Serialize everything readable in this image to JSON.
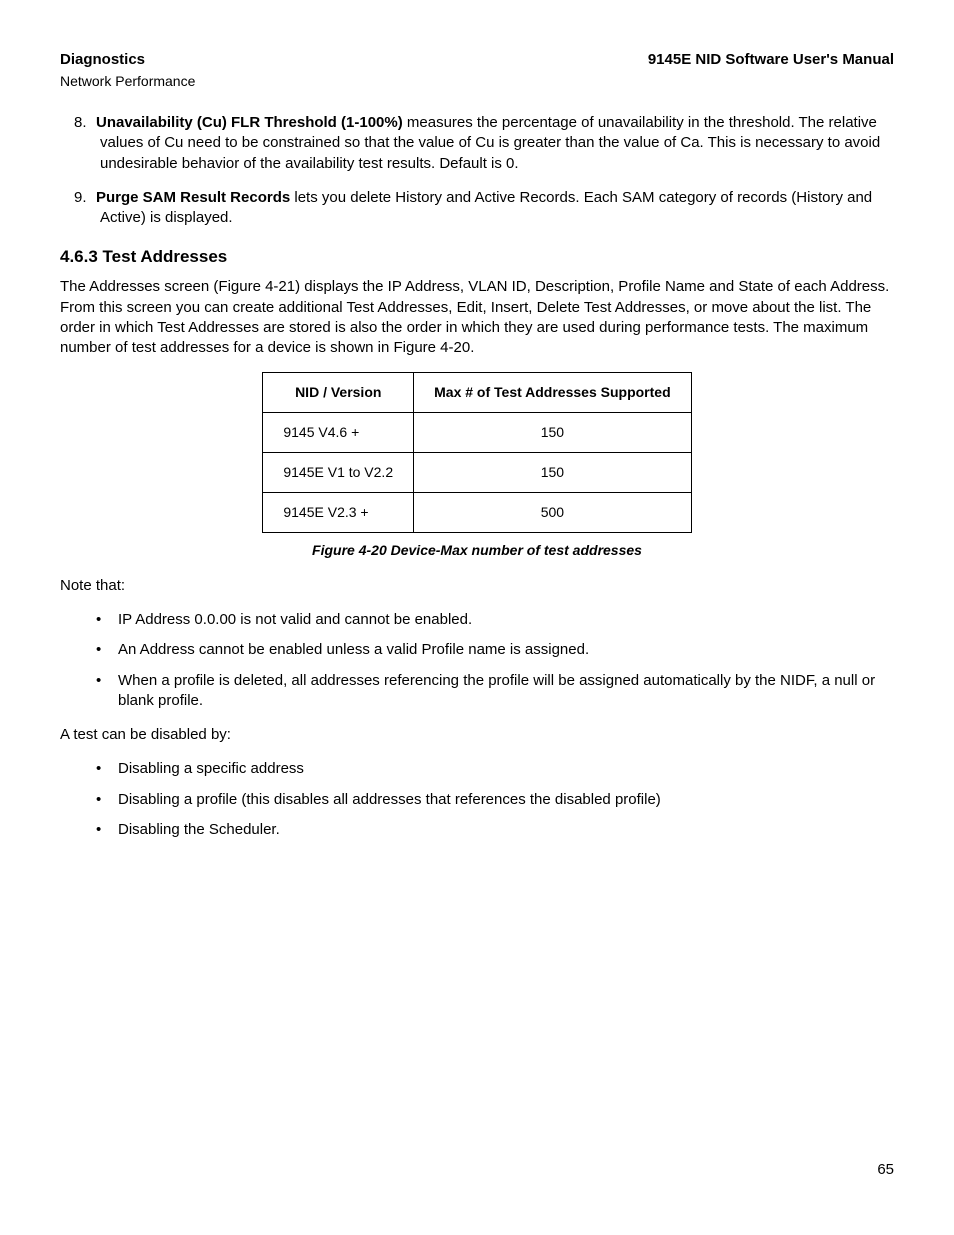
{
  "header": {
    "left": "Diagnostics",
    "right": "9145E NID Software User's Manual",
    "sub": "Network Performance"
  },
  "list1": {
    "item8": {
      "num": "8.",
      "bold": "Unavailability (Cu) FLR Threshold (1-100%)",
      "rest": "  measures the percentage of unavailability in the threshold. The relative values of Cu need to be constrained so that the value of Cu is greater than the value of Ca. This is necessary to avoid undesirable behavior of the availability test results. Default is 0."
    },
    "item9": {
      "num": "9.",
      "bold": "Purge SAM Result Records",
      "rest": " lets you delete History and Active Records. Each SAM category of records (History and Active) is displayed."
    }
  },
  "section": {
    "heading": "4.6.3  Test Addresses",
    "para": "The Addresses screen (Figure 4-21) displays the IP Address, VLAN ID, Description, Profile Name and State of each Address. From this screen you can create additional Test Addresses, Edit, Insert, Delete Test Addresses, or move about the list. The order in which Test Addresses are stored is also the order in which they are used during performance tests. The maximum number of test addresses for a device is shown in Figure 4-20."
  },
  "table": {
    "h1": "NID / Version",
    "h2": "Max # of Test Addresses Supported",
    "rows": [
      {
        "c1": "9145 V4.6 +",
        "c2": "150"
      },
      {
        "c1": "9145E V1 to V2.2",
        "c2": "150"
      },
      {
        "c1": "9145E V2.3 +",
        "c2": "500"
      }
    ]
  },
  "caption": "Figure 4-20  Device-Max number of test addresses",
  "note_intro": "Note that:",
  "notes": [
    "IP Address 0.0.00 is not valid and cannot be enabled.",
    "An Address cannot be enabled unless a valid Profile name is assigned.",
    "When a profile is deleted, all addresses referencing the profile will be assigned automatically by the NIDF, a null or blank profile."
  ],
  "disable_intro": "A test can be disabled by:",
  "disables": [
    "Disabling a specific address",
    "Disabling a profile (this disables all addresses that references the disabled profile)",
    "Disabling the Scheduler."
  ],
  "pagenum": "65"
}
